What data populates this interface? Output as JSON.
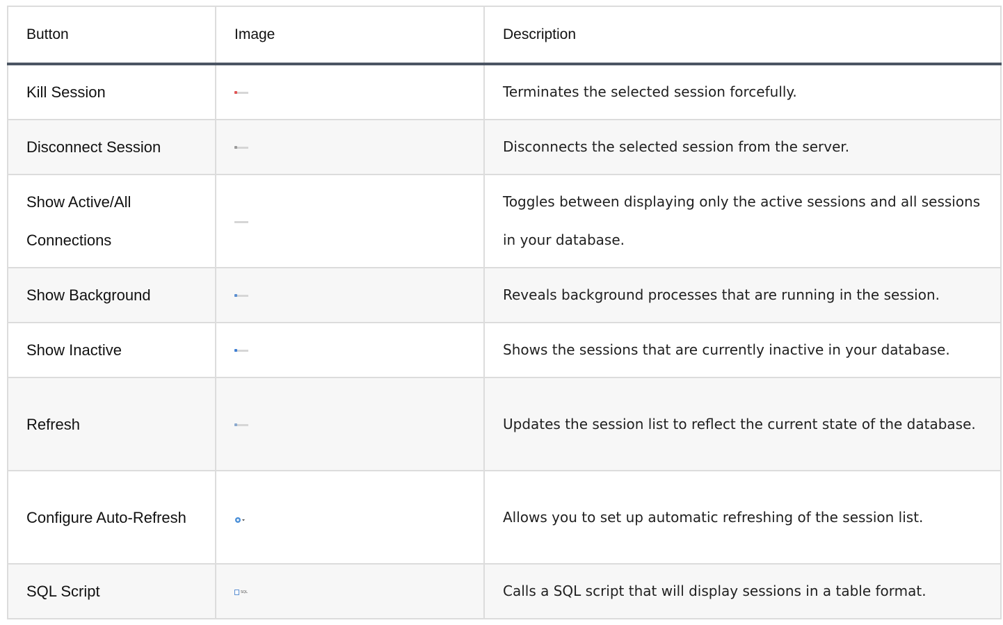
{
  "table": {
    "headers": [
      "Button",
      "Image",
      "Description"
    ],
    "rows": [
      {
        "button": "Kill Session",
        "image_icon": "kill-session-thumbnail",
        "image_color": "#e05555",
        "description": "Terminates the selected session forcefully."
      },
      {
        "button": "Disconnect Session",
        "image_icon": "disconnect-session-thumbnail",
        "image_color": "#9a9a9a",
        "description": "Disconnects the selected session from the server."
      },
      {
        "button": "Show Active/All Connections",
        "image_icon": "show-active-all-thumbnail",
        "image_color": "#b0b0b0",
        "description": "Toggles between displaying only the active sessions and all sessions in your database."
      },
      {
        "button": "Show Background",
        "image_icon": "show-background-thumbnail",
        "image_color": "#5b8fd1",
        "description": "Reveals background processes that are running in the session."
      },
      {
        "button": "Show Inactive",
        "image_icon": "show-inactive-thumbnail",
        "image_color": "#3f7fd4",
        "description": "Shows the sessions that are currently inactive in your database."
      },
      {
        "button": "Refresh",
        "image_icon": "refresh-thumbnail",
        "image_color": "#8aa9cf",
        "description": "Updates the session list to reflect the current state of the database."
      },
      {
        "button": "Configure Auto-Refresh",
        "image_icon": "auto-refresh-icon",
        "image_color": "#4a8fd8",
        "description": "Allows you to set up automatic refreshing of the session list."
      },
      {
        "button": "SQL Script",
        "image_icon": "sql-script-thumbnail",
        "image_label": "SQL",
        "description": "Calls a SQL script that will display sessions in a table format."
      }
    ]
  }
}
